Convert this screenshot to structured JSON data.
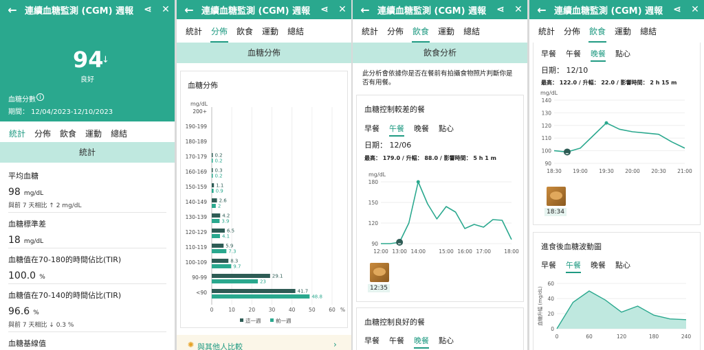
{
  "title": "連續血糖監測 (CGM) 週報",
  "tabs": [
    "統計",
    "分佈",
    "飲食",
    "運動",
    "總結"
  ],
  "p1": {
    "score": "94",
    "arrow": "↓",
    "grade": "良好",
    "score_label": "血糖分數",
    "period": "期間： 12/04/2023-12/10/2023",
    "band": "統計",
    "stats": [
      {
        "label": "平均血糖",
        "value": "98",
        "unit": "mg/dL",
        "sub": "與前 7 天相比 ↑ 2 mg/dL"
      },
      {
        "label": "血糖標準差",
        "value": "18",
        "unit": "mg/dL",
        "sub": ""
      },
      {
        "label": "血糖值在70-180的時間佔比(TIR)",
        "value": "100.0",
        "unit": "%",
        "sub": ""
      },
      {
        "label": "血糖值在70-140的時間佔比(TIR)",
        "value": "96.6",
        "unit": "%",
        "sub": "與前 7 天相比 ↓ 0.3 %"
      },
      {
        "label": "血糖基線值",
        "value": "",
        "unit": "",
        "sub": ""
      }
    ]
  },
  "p2": {
    "band": "血糖分佈",
    "card_title": "血糖分佈",
    "unit": "mg/dL",
    "legend": [
      "這一週",
      "前一週"
    ],
    "compare": "與其他人比較",
    "pct": "%",
    "chart_data": {
      "type": "bar",
      "categories": [
        "200+",
        "190-199",
        "180-189",
        "170-179",
        "160-169",
        "150-159",
        "140-149",
        "130-139",
        "120-129",
        "110-119",
        "100-109",
        "90-99",
        "<90"
      ],
      "series": [
        {
          "name": "這一週",
          "values": [
            null,
            null,
            null,
            0.2,
            0.3,
            1.1,
            2.6,
            4.2,
            6.5,
            5.9,
            8.3,
            29.1,
            41.7
          ]
        },
        {
          "name": "前一週",
          "values": [
            null,
            null,
            null,
            0.2,
            0.2,
            0.9,
            2,
            3.9,
            4.1,
            7.3,
            9.7,
            23,
            48.8
          ]
        }
      ],
      "xticks": [
        "0",
        "10",
        "20",
        "30",
        "40",
        "50",
        "60"
      ],
      "xlim": [
        0,
        60
      ],
      "xlabel": "%",
      "ylabel": "mg/dL"
    }
  },
  "p3": {
    "band": "飲食分析",
    "desc": "此分析會依據你是否在餐前有拍攝食物照片判斷你是否有用餐。",
    "worst_title": "血糖控制較差的餐",
    "meals": [
      "早餐",
      "午餐",
      "晚餐",
      "點心"
    ],
    "date": "日期： 12/06",
    "stats": "最高： 179.0 / 升幅： 88.0 / 影響時間： 5 h 1 m",
    "unit": "mg/dL",
    "photo_time": "12:35",
    "best_title": "血糖控制良好的餐",
    "chart_data": {
      "type": "line",
      "x": [
        "12:00",
        "12:30",
        "13:00",
        "13:30",
        "14:00",
        "14:20",
        "14:40",
        "15:00",
        "15:30",
        "16:00",
        "16:30",
        "17:00",
        "17:30",
        "17:45",
        "18:00"
      ],
      "y": [
        90,
        90,
        92,
        120,
        180,
        148,
        126,
        144,
        136,
        112,
        118,
        114,
        125,
        124,
        96
      ],
      "yticks": [
        90,
        120,
        150,
        180
      ],
      "xticks": [
        "12:00",
        "13:00",
        "14:00",
        "15:00",
        "16:00",
        "17:00",
        "18:00"
      ],
      "ylim": [
        90,
        180
      ]
    }
  },
  "p4": {
    "meals": [
      "早餐",
      "午餐",
      "晚餐",
      "點心"
    ],
    "date": "日期： 12/10",
    "stats": "最高： 122.0 / 升幅： 22.0 / 影響時間： 2 h 15 m",
    "unit": "mg/dL",
    "photo_time": "18:34",
    "wave_title": "進食後血糖波動圖",
    "wave_ylabel": "血糖升幅 (mg/dL)",
    "chart_data": [
      {
        "type": "line",
        "x": [
          "18:30",
          "18:45",
          "19:00",
          "19:15",
          "19:30",
          "19:45",
          "20:00",
          "20:15",
          "20:30",
          "20:45",
          "21:00"
        ],
        "y": [
          100,
          99,
          102,
          112,
          122,
          117,
          115,
          114,
          113,
          107,
          102
        ],
        "yticks": [
          90,
          100,
          110,
          120,
          130,
          140
        ],
        "xticks": [
          "18:30",
          "19:00",
          "19:30",
          "20:00",
          "20:30",
          "21:00"
        ],
        "ylim": [
          90,
          140
        ]
      },
      {
        "type": "area",
        "x": [
          0,
          30,
          60,
          90,
          120,
          150,
          180,
          210,
          240
        ],
        "y": [
          0,
          35,
          50,
          38,
          22,
          30,
          18,
          13,
          12
        ],
        "yticks": [
          0,
          20,
          40,
          60
        ],
        "xticks": [
          "0",
          "60",
          "120",
          "180",
          "240"
        ],
        "ylim": [
          0,
          60
        ]
      }
    ]
  }
}
